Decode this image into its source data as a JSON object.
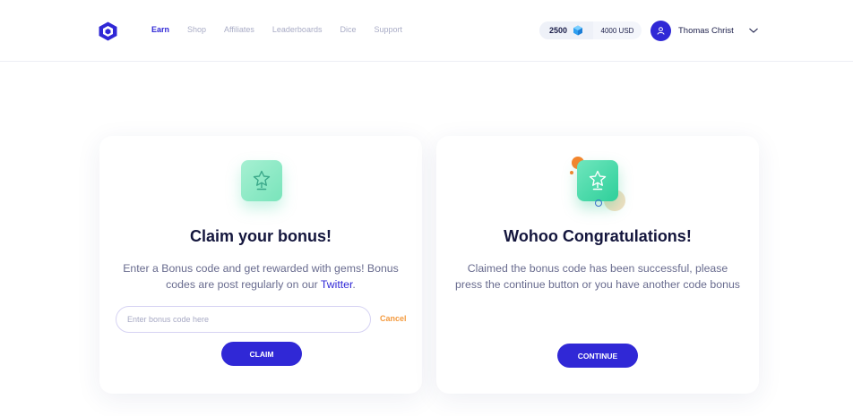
{
  "header": {
    "nav": [
      {
        "label": "Earn",
        "active": true
      },
      {
        "label": "Shop"
      },
      {
        "label": "Affiliates"
      },
      {
        "label": "Leaderboards"
      },
      {
        "label": "Dice"
      },
      {
        "label": "Support"
      }
    ],
    "balance": {
      "gems": "2500",
      "usd": "4000 USD"
    },
    "user": {
      "name": "Thomas Christ"
    }
  },
  "claim_card": {
    "title": "Claim your bonus!",
    "text_before": "Enter a Bonus code and get rewarded with gems! Bonus codes are post regularly on our ",
    "link": "Twitter",
    "text_after": ".",
    "input": {
      "placeholder": "Enter bonus code here",
      "value": ""
    },
    "cancel_label": "Cancel",
    "claim_label": "CLAIM"
  },
  "success_card": {
    "title": "Wohoo Congratulations!",
    "text": "Claimed the bonus code has been successful, please press the continue button or you have another code bonus",
    "continue_label": "CONTINUE"
  },
  "colors": {
    "accent": "#3028d6",
    "cancel": "#f49a3e",
    "badge_green": "#79e4bb"
  }
}
